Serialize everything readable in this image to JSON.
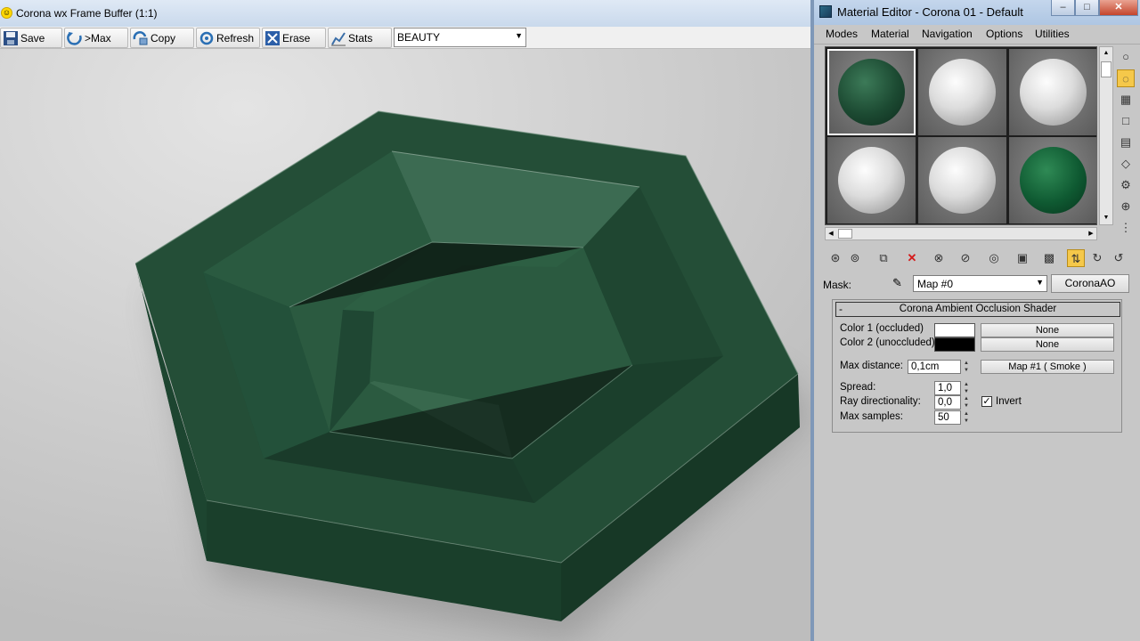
{
  "framebuffer": {
    "title": "Corona wx Frame Buffer (1:1)",
    "toolbar": {
      "save": "Save",
      "max": ">Max",
      "copy": "Copy",
      "refresh": "Refresh",
      "erase": "Erase",
      "stats": "Stats"
    },
    "channel": "BEAUTY",
    "object_color": "#1f4a33"
  },
  "material_editor": {
    "title": "Material Editor - Corona 01 - Default",
    "menu": [
      "Modes",
      "Material",
      "Navigation",
      "Options",
      "Utilities"
    ],
    "slots": [
      "green-speckled",
      "white",
      "white",
      "white",
      "white",
      "green"
    ],
    "mask_label": "Mask:",
    "map_selected": "Map #0",
    "map_type": "CoronaAO",
    "rollout": {
      "collapse": "-",
      "title": "Corona Ambient Occlusion Shader",
      "color1_label": "Color 1 (occluded)",
      "color1_swatch": "#ffffff",
      "color1_map": "None",
      "color2_label": "Color 2 (unoccluded)",
      "color2_swatch": "#000000",
      "color2_map": "None",
      "max_distance_label": "Max distance:",
      "max_distance": "0,1cm",
      "max_distance_map": "Map #1  ( Smoke )",
      "spread_label": "Spread:",
      "spread": "1,0",
      "ray_dir_label": "Ray directionality:",
      "ray_dir": "0,0",
      "max_samples_label": "Max samples:",
      "max_samples": "50",
      "invert_label": "Invert",
      "invert_checked": "✓"
    }
  }
}
